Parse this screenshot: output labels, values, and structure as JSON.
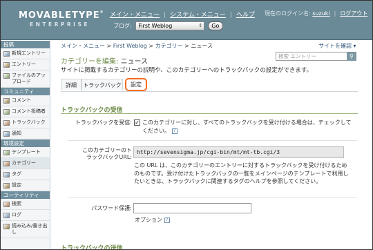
{
  "header": {
    "logo_main": "MOVABLETYPE",
    "logo_tm": "®",
    "logo_sub": "ENTERPRISE",
    "nav": [
      "メイン・メニュー",
      "システム・メニュー",
      "ヘルプ"
    ],
    "user_prefix": "現在のログイン名:",
    "user_name": "suzuki",
    "logout": "ログアウト",
    "blog_label": "ブログ:",
    "blog_selected": "First Weblog",
    "go_label": "Go"
  },
  "sidebar": {
    "sections": [
      {
        "title": "投稿",
        "items": [
          {
            "label": "新規エントリー",
            "icon": "new-entry-icon"
          },
          {
            "label": "エントリー",
            "icon": "entries-icon"
          },
          {
            "label": "ファイルのアップロード",
            "icon": "upload-icon"
          }
        ]
      },
      {
        "title": "コミュニティ",
        "items": [
          {
            "label": "コメント",
            "icon": "comment-icon"
          },
          {
            "label": "コメント投稿者",
            "icon": "commenter-icon"
          },
          {
            "label": "トラックバック",
            "icon": "trackback-icon"
          },
          {
            "label": "通知",
            "icon": "notification-icon"
          }
        ]
      },
      {
        "title": "環境設定",
        "items": [
          {
            "label": "テンプレート",
            "icon": "template-icon"
          },
          {
            "label": "カテゴリー",
            "icon": "category-icon"
          },
          {
            "label": "タグ",
            "icon": "tag-icon"
          },
          {
            "label": "設定",
            "icon": "settings-icon"
          }
        ]
      },
      {
        "title": "ユーティリティ",
        "items": [
          {
            "label": "検索",
            "icon": "search-icon"
          },
          {
            "label": "ログ",
            "icon": "log-icon"
          },
          {
            "label": "読み込み/書き出し",
            "icon": "import-export-icon"
          }
        ]
      }
    ]
  },
  "breadcrumb": {
    "items": [
      "メイン・メニュー",
      "First Weblog",
      "カテゴリー",
      "ニュース"
    ],
    "sep": ">"
  },
  "site_check": "サイトを確認 ▾",
  "search": {
    "placeholder": "検索 エントリー"
  },
  "page": {
    "title_prefix": "カテゴリーを編集:",
    "title_name": "ニュース",
    "description": "サイトに掲載するカテゴリーの説明や、このカテゴリーへのトラックバックの設定ができます。"
  },
  "tabs": [
    "詳細",
    "トラックバック",
    "設定"
  ],
  "form": {
    "section_title": "トラックバックの受信",
    "accept_label": "トラックバックを受信:",
    "accept_text": "このカテゴリーに対し、すべてのトラックバックを受け付ける場合は、チェックしてください。",
    "accept_checked": true,
    "url_label_1": "このカテゴリーのト",
    "url_label_2": "ラックバックURL:",
    "url_value": "http://sevensigma.jp/cgi-bin/mt/mt-tb.cgi/3",
    "url_hint": "この URL は、このカテゴリーのエントリーに対するトラックバックを受け付けるためのものです。受け付けたトラックバックの一覧をメインページのテンプレートで利用したいときは、トラックバックに関連するタグのヘルプを参照してください。",
    "password_label": "パスワード保護:",
    "password_value": "",
    "option_label": "オプション",
    "next_section_title": "トラックバックの送信"
  },
  "colors": {
    "header_bg": "#6b8a97",
    "section_green": "#6e8b48",
    "tab_highlight": "#f26b1d"
  }
}
